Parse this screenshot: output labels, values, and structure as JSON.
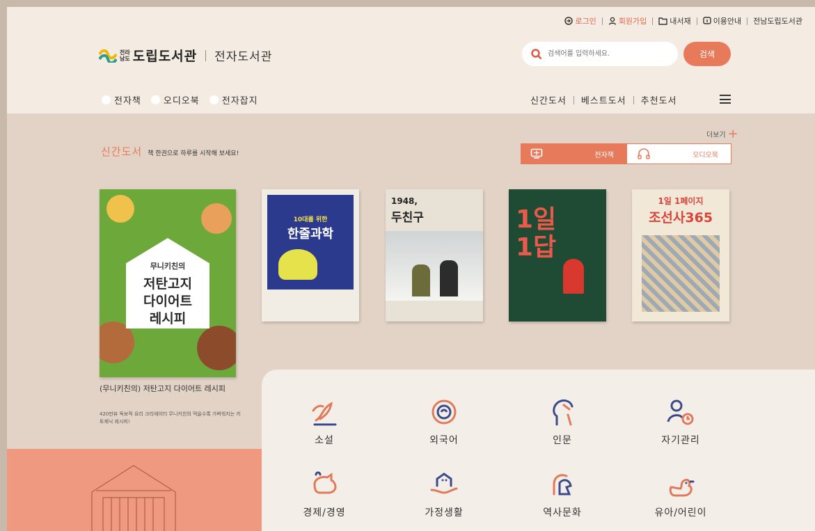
{
  "top_nav": {
    "login": "로그인",
    "signup": "회원가입",
    "my_library": "내서재",
    "guide": "이용안내",
    "library_name": "전남도립도서관"
  },
  "logo": {
    "small_line1": "전라",
    "small_line2": "남도",
    "main": "도립도서관",
    "sub": "전자도서관"
  },
  "search": {
    "placeholder": "검색어를 입력하세요.",
    "button": "검색"
  },
  "categories": [
    "전자책",
    "오디오북",
    "전자잡지"
  ],
  "right_nav": [
    "신간도서",
    "베스트도서",
    "추천도서"
  ],
  "new_books": {
    "more_label": "더보기",
    "title": "신간도서",
    "subtitle": "책 한권으로 하루를 시작해 보세요!",
    "tab_ebook": "전자책",
    "tab_audiobook": "오디오북",
    "featured_title": "(무니키친의) 저탄고지 다이어트 레시피",
    "featured_desc": "420만뷰 독보적 요리 크리에이터 무니키친의 먹을수록 가벼워지는 키토제닉 레시피!",
    "covers": [
      {
        "title": "저탄고지 다이어트 레시피",
        "pretitle": "무니키친의"
      },
      {
        "title": "한줄과학",
        "pretitle": "10대를 위한"
      },
      {
        "title": "두친구",
        "pretitle": "1948,"
      },
      {
        "title": "1일 1답",
        "pretitle": ""
      },
      {
        "title": "조선사365",
        "pretitle": "1일 1페이지"
      }
    ]
  },
  "genres": [
    "소설",
    "외국어",
    "인문",
    "자기관리",
    "경제/경영",
    "가정생활",
    "역사문화",
    "유아/어린이"
  ],
  "colors": {
    "accent": "#e87a5c",
    "header_bg": "#f4ebe2",
    "section_bg": "#e2d3c6"
  }
}
